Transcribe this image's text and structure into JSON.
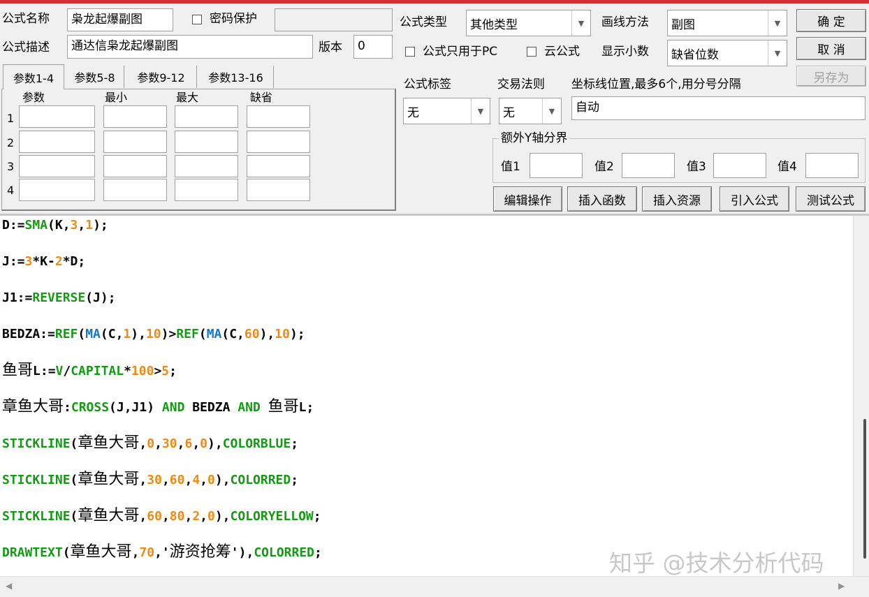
{
  "formula": {
    "name_label": "公式名称",
    "name_value": "枭龙起爆副图",
    "password_label": "密码保护",
    "password_value": "",
    "desc_label": "公式描述",
    "desc_value": "通达信枭龙起爆副图",
    "version_label": "版本",
    "version_value": "0",
    "type_label": "公式类型",
    "type_value": "其他类型",
    "draw_method_label": "画线方法",
    "draw_method_value": "副图",
    "pc_only_label": "公式只用于PC",
    "cloud_label": "云公式",
    "decimals_label": "显示小数",
    "decimals_value": "缺省位数"
  },
  "buttons": {
    "ok": "确 定",
    "cancel": "取 消",
    "save_as": "另存为",
    "edit_ops": "编辑操作",
    "insert_func": "插入函数",
    "insert_res": "插入资源",
    "import_formula": "引入公式",
    "test_formula": "测试公式"
  },
  "tabs": [
    "参数1-4",
    "参数5-8",
    "参数9-12",
    "参数13-16"
  ],
  "params": {
    "headers": [
      "参数",
      "最小",
      "最大",
      "缺省"
    ],
    "rows": [
      "1",
      "2",
      "3",
      "4"
    ]
  },
  "tags": {
    "label": "公式标签",
    "value": "无",
    "trade_rule_label": "交易法则",
    "trade_rule_value": "无",
    "coord_label": "坐标线位置,最多6个,用分号分隔",
    "coord_value": "自动"
  },
  "y_axis": {
    "title": "额外Y轴分界",
    "v1": "值1",
    "v2": "值2",
    "v3": "值3",
    "v4": "值4"
  },
  "code_lines": [
    [
      [
        "id",
        "D:="
      ],
      [
        "fn",
        "SMA"
      ],
      [
        "id",
        "(K,"
      ],
      [
        "num",
        "3"
      ],
      [
        "id",
        ","
      ],
      [
        "num",
        "1"
      ],
      [
        "id",
        ");"
      ]
    ],
    [
      [
        "id",
        "J:="
      ],
      [
        "num",
        "3"
      ],
      [
        "id",
        "*K-"
      ],
      [
        "num",
        "2"
      ],
      [
        "id",
        "*D;"
      ]
    ],
    [
      [
        "id",
        "J1:="
      ],
      [
        "fn",
        "REVERSE"
      ],
      [
        "id",
        "(J);"
      ]
    ],
    [
      [
        "id",
        "BEDZA:="
      ],
      [
        "fn",
        "REF"
      ],
      [
        "id",
        "("
      ],
      [
        "fn2",
        "MA"
      ],
      [
        "id",
        "(C,"
      ],
      [
        "num",
        "1"
      ],
      [
        "id",
        "),"
      ],
      [
        "num",
        "10"
      ],
      [
        "id",
        ")>"
      ],
      [
        "fn",
        "REF"
      ],
      [
        "id",
        "("
      ],
      [
        "fn2",
        "MA"
      ],
      [
        "id",
        "(C,"
      ],
      [
        "num",
        "60"
      ],
      [
        "id",
        "),"
      ],
      [
        "num",
        "10"
      ],
      [
        "id",
        ");"
      ]
    ],
    [
      [
        "cn",
        "鱼哥"
      ],
      [
        "id",
        "L:="
      ],
      [
        "fn",
        "V"
      ],
      [
        "id",
        "/"
      ],
      [
        "fn",
        "CAPITAL"
      ],
      [
        "id",
        "*"
      ],
      [
        "num",
        "100"
      ],
      [
        "id",
        ">"
      ],
      [
        "num",
        "5"
      ],
      [
        "id",
        ";"
      ]
    ],
    [
      [
        "cn",
        "章鱼大哥"
      ],
      [
        "id",
        ":"
      ],
      [
        "fn",
        "CROSS"
      ],
      [
        "id",
        "(J,J1) "
      ],
      [
        "fn",
        "AND"
      ],
      [
        "id",
        " BEDZA "
      ],
      [
        "fn",
        "AND"
      ],
      [
        "id",
        " "
      ],
      [
        "cn",
        "鱼哥"
      ],
      [
        "id",
        "L;"
      ]
    ],
    [
      [
        "fn",
        "STICKLINE"
      ],
      [
        "id",
        "("
      ],
      [
        "cn",
        "章鱼大哥"
      ],
      [
        "id",
        ","
      ],
      [
        "num",
        "0"
      ],
      [
        "id",
        ","
      ],
      [
        "num",
        "30"
      ],
      [
        "id",
        ","
      ],
      [
        "num",
        "6"
      ],
      [
        "id",
        ","
      ],
      [
        "num",
        "0"
      ],
      [
        "id",
        "),"
      ],
      [
        "fn",
        "COLORBLUE"
      ],
      [
        "id",
        ";"
      ]
    ],
    [
      [
        "fn",
        "STICKLINE"
      ],
      [
        "id",
        "("
      ],
      [
        "cn",
        "章鱼大哥"
      ],
      [
        "id",
        ","
      ],
      [
        "num",
        "30"
      ],
      [
        "id",
        ","
      ],
      [
        "num",
        "60"
      ],
      [
        "id",
        ","
      ],
      [
        "num",
        "4"
      ],
      [
        "id",
        ","
      ],
      [
        "num",
        "0"
      ],
      [
        "id",
        "),"
      ],
      [
        "fn",
        "COLORRED"
      ],
      [
        "id",
        ";"
      ]
    ],
    [
      [
        "fn",
        "STICKLINE"
      ],
      [
        "id",
        "("
      ],
      [
        "cn",
        "章鱼大哥"
      ],
      [
        "id",
        ","
      ],
      [
        "num",
        "60"
      ],
      [
        "id",
        ","
      ],
      [
        "num",
        "80"
      ],
      [
        "id",
        ","
      ],
      [
        "num",
        "2"
      ],
      [
        "id",
        ","
      ],
      [
        "num",
        "0"
      ],
      [
        "id",
        "),"
      ],
      [
        "fn",
        "COLORYELLOW"
      ],
      [
        "id",
        ";"
      ]
    ],
    [
      [
        "fn",
        "DRAWTEXT"
      ],
      [
        "id",
        "("
      ],
      [
        "cn",
        "章鱼大哥"
      ],
      [
        "id",
        ","
      ],
      [
        "num",
        "70"
      ],
      [
        "id",
        ",'"
      ],
      [
        "cn",
        "游资抢筹"
      ],
      [
        "id",
        "'),"
      ],
      [
        "fn",
        "COLORRED"
      ],
      [
        "id",
        ";"
      ]
    ]
  ],
  "watermark": "知乎 @技术分析代码",
  "colors": {
    "top_bar": "#d03030",
    "keyword_green": "#149a14",
    "func_blue": "#1478c8",
    "number_orange": "#f08a10"
  }
}
